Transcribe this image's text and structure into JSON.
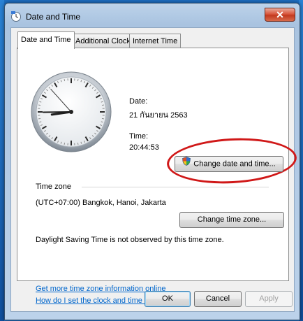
{
  "window": {
    "title": "Date and Time",
    "close_label": "✕"
  },
  "tabs": [
    {
      "label": "Date and Time",
      "active": true
    },
    {
      "label": "Additional Clocks",
      "active": false
    },
    {
      "label": "Internet Time",
      "active": false
    }
  ],
  "datetime": {
    "date_label": "Date:",
    "date_value": "21 กันยายน 2563",
    "time_label": "Time:",
    "time_value": "20:44:53",
    "change_button": "Change date and time...",
    "clock": {
      "hours": 20,
      "minutes": 44,
      "seconds": 53
    }
  },
  "timezone": {
    "section_label": "Time zone",
    "value": "(UTC+07:00) Bangkok, Hanoi, Jakarta",
    "change_button": "Change time zone...",
    "dst_note": "Daylight Saving Time is not observed by this time zone."
  },
  "links": {
    "more_info": "Get more time zone information online",
    "how_to": "How do I set the clock and time zone?"
  },
  "footer": {
    "ok": "OK",
    "cancel": "Cancel",
    "apply": "Apply"
  },
  "colors": {
    "highlight": "#d01818",
    "link": "#0066cc"
  }
}
